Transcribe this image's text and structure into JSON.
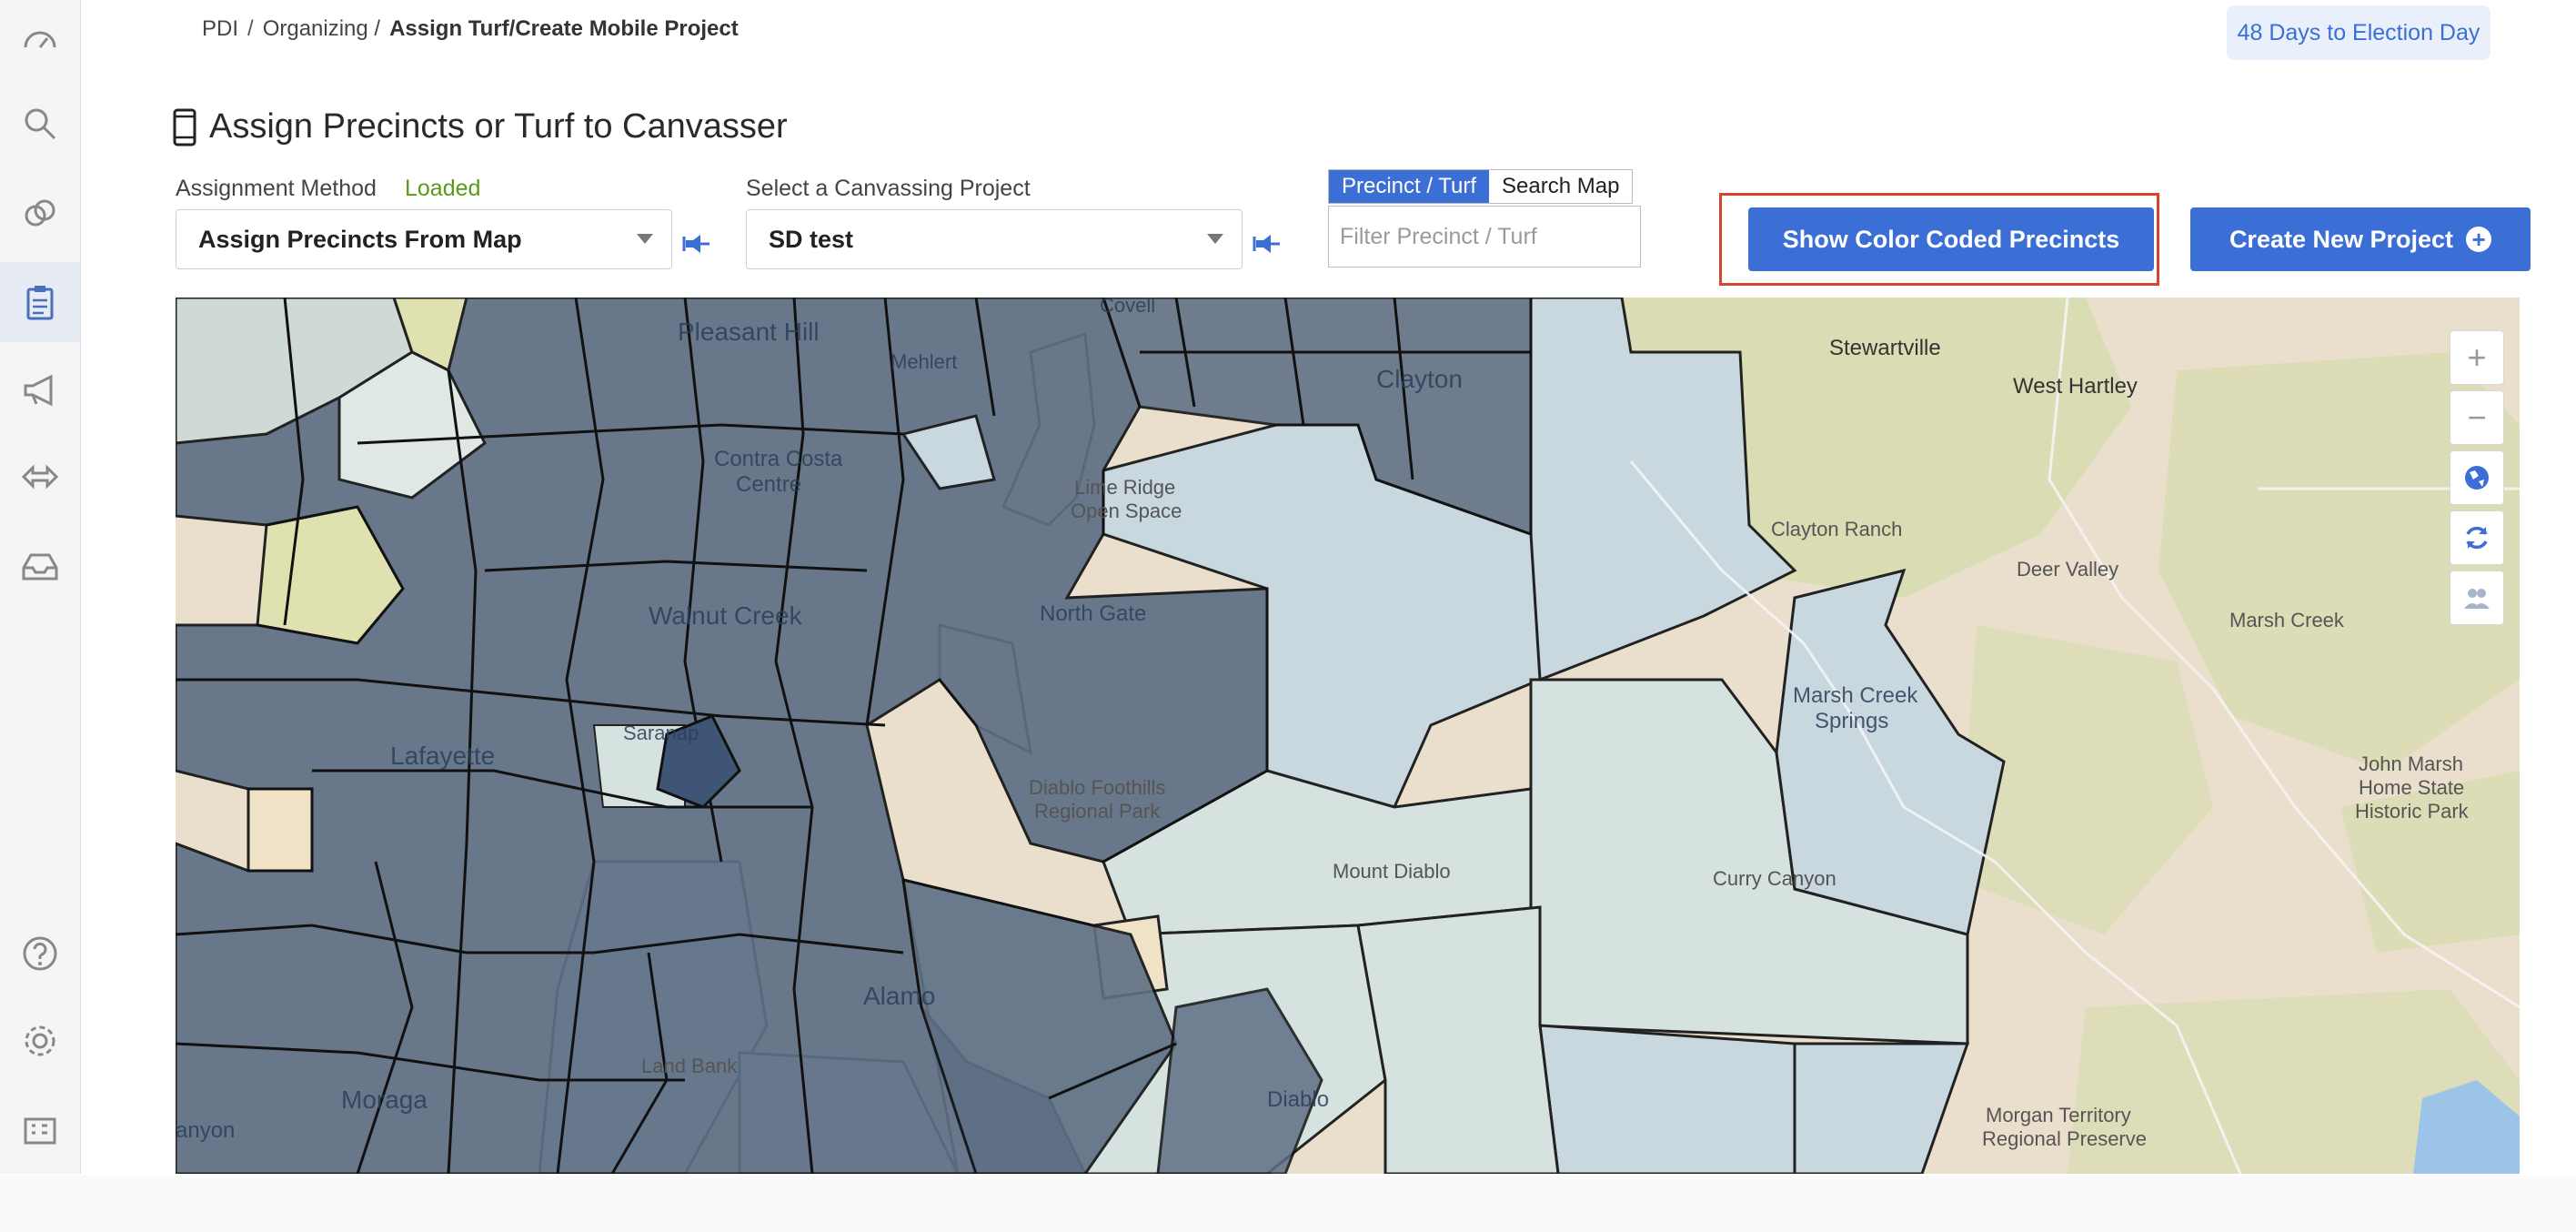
{
  "breadcrumb": {
    "root": "PDI",
    "sep1": "/",
    "parent": "Organizing /",
    "current": "Assign Turf/Create Mobile Project"
  },
  "election_badge": "48 Days to Election Day",
  "page_title": "Assign Precincts or Turf to Canvasser",
  "assignment": {
    "label": "Assignment Method",
    "status": "Loaded",
    "selected": "Assign Precincts From Map"
  },
  "project": {
    "label": "Select a Canvassing Project",
    "selected": "SD test"
  },
  "toggle": {
    "precinct_turf": "Precinct / Turf",
    "search_map": "Search Map"
  },
  "filter": {
    "placeholder": "Filter Precinct / Turf"
  },
  "buttons": {
    "show_color_coded": "Show Color Coded Precincts",
    "create_project": "Create New Project"
  },
  "map": {
    "labels": {
      "pleasant_hill": "Pleasant Hill",
      "martinez": "Mehlert",
      "contra_costa": "Contra Costa",
      "contra_costa2": "Centre",
      "clayton": "Clayton",
      "lime_ridge": "Lime Ridge",
      "lime_ridge2": "Open Space",
      "walnut_creek": "Walnut Creek",
      "north_gate": "North Gate",
      "lafayette": "Lafayette",
      "saranap": "Saranap",
      "diablo_foothills": "Diablo Foothills",
      "regional_park": "Regional Park",
      "mount_diablo": "Mount Diablo",
      "alamo": "Alamo",
      "land_bank": "Land Bank",
      "diablo": "Diablo",
      "moraga": "Moraga",
      "canyon": "anyon",
      "stewartville": "Stewartville",
      "west_hartley": "West Hartley",
      "clayton_ranch": "Clayton Ranch",
      "deer_valley": "Deer Valley",
      "marsh_creek": "Marsh Creek",
      "marsh_creek_springs": "Marsh Creek",
      "marsh_creek_springs2": "Springs",
      "curry_canyon": "Curry Canyon",
      "john_marsh": "John Marsh",
      "john_marsh2": "Home State",
      "john_marsh3": "Historic Park",
      "morgan_territory": "Morgan Territory",
      "morgan_territory2": "Regional Preserve",
      "covell": "Covell"
    },
    "controls": {
      "zoom_in": "+",
      "zoom_out": "−"
    }
  },
  "colors": {
    "accent": "#3b6fd6",
    "precinct_dark": "#5f6f85",
    "precinct_light": "#c9d7df",
    "terrain": "#eadfcc",
    "parkland": "#d6dcae",
    "highlight": "#d9442f"
  }
}
